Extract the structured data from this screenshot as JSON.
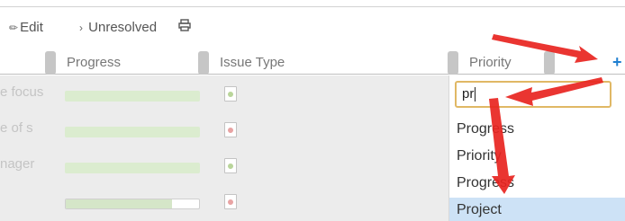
{
  "toolbar": {
    "edit_label": "Edit",
    "unresolved_label": "Unresolved",
    "print_icon": "printer-icon"
  },
  "columns": {
    "progress": "Progress",
    "issue_type": "Issue Type",
    "priority": "Priority",
    "add_icon": "+"
  },
  "rows": [
    {
      "title": "e focus",
      "progress": 1.0,
      "issue_status": "green"
    },
    {
      "title": "e of s",
      "progress": 1.0,
      "issue_status": "red"
    },
    {
      "title": "nager",
      "progress": 1.0,
      "issue_status": "green"
    },
    {
      "title": "",
      "progress": 0.8,
      "issue_status": "red"
    }
  ],
  "column_picker": {
    "query": "pr",
    "options": [
      "Progress",
      "Priority",
      "Progress",
      "Project"
    ],
    "selected_index": 3
  },
  "colors": {
    "accent_blue": "#1f7fd0",
    "input_focus": "#e0b865",
    "selected_option": "#cde2f6",
    "annotation_arrow": "#e8241f"
  }
}
